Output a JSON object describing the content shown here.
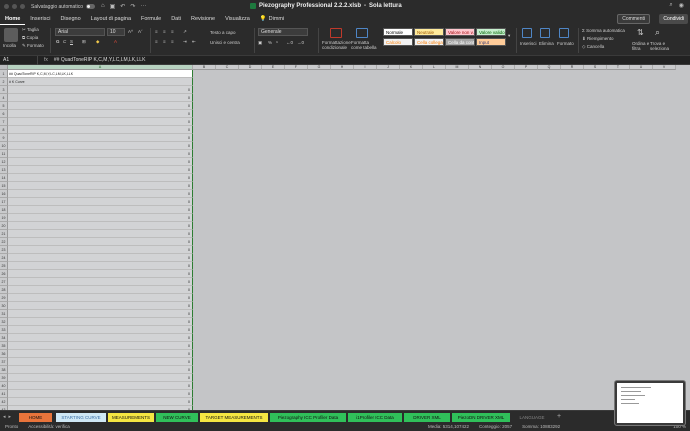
{
  "titlebar": {
    "autosave_label": "Salvataggio automatico",
    "document_title": "Piezography Professional 2.2.2.xlsb",
    "mode": "Sola lettura"
  },
  "menu": {
    "tabs": [
      "Home",
      "Inserisci",
      "Disegno",
      "Layout di pagina",
      "Formule",
      "Dati",
      "Revisione",
      "Visualizza"
    ],
    "tell_me": "Dimmi",
    "comments": "Commenti",
    "share": "Condividi"
  },
  "ribbon": {
    "paste": "Incolla",
    "cut": "Taglia",
    "copy": "Copia",
    "format_painter": "Formato",
    "font_name": "Arial",
    "font_size": "10",
    "wrap_text": "Testo a capo",
    "merge_center": "Unisci e centra",
    "number_format": "Generale",
    "conditional_format": "Formattazione condizionale",
    "format_as_table": "Formatta come tabella",
    "cell_styles": [
      {
        "label": "Normale",
        "bg": "#ffffff",
        "fg": "#000000"
      },
      {
        "label": "Neutrale",
        "bg": "#ffeb9c",
        "fg": "#9c5700"
      },
      {
        "label": "Valore non v...",
        "bg": "#ffc7ce",
        "fg": "#9c0006"
      },
      {
        "label": "Valore valido",
        "bg": "#c6efce",
        "fg": "#006100"
      },
      {
        "label": "Calcolo",
        "bg": "#f2f2f2",
        "fg": "#fa7d00"
      },
      {
        "label": "Cella collegata",
        "bg": "#f2f2f2",
        "fg": "#fa7d00"
      },
      {
        "label": "Cella da cont...",
        "bg": "#a5a5a5",
        "fg": "#ffffff"
      },
      {
        "label": "Input",
        "bg": "#ffcc99",
        "fg": "#3f3f76"
      }
    ],
    "insert": "Inserisci",
    "delete": "Elimina",
    "format": "Formato",
    "autosum": "Somma automatica",
    "fill": "Riempimento",
    "clear": "Cancella",
    "sort_filter": "Ordina e filtra",
    "find_select": "Trova e seleziona"
  },
  "formula_bar": {
    "name_box": "A1",
    "fx": "fx",
    "content": "## QuadToneRIP K,C,M,Y,LC,LM,LK,LLK"
  },
  "grid": {
    "columns": [
      "A",
      "B",
      "C",
      "D",
      "E",
      "F",
      "G",
      "H",
      "I",
      "J",
      "K",
      "L",
      "M",
      "N",
      "O",
      "P",
      "Q",
      "R",
      "S",
      "T",
      "U",
      "V"
    ],
    "rows": [
      {
        "n": "1",
        "a": "## QuadToneRIP K,C,M,Y,LC,LM,LK,LLK",
        "v": ""
      },
      {
        "n": "2",
        "a": "# K Curve",
        "v": ""
      },
      {
        "n": "3",
        "a": "",
        "v": "0"
      },
      {
        "n": "4",
        "a": "",
        "v": "0"
      },
      {
        "n": "5",
        "a": "",
        "v": "0"
      },
      {
        "n": "6",
        "a": "",
        "v": "0"
      },
      {
        "n": "7",
        "a": "",
        "v": "0"
      },
      {
        "n": "8",
        "a": "",
        "v": "0"
      },
      {
        "n": "9",
        "a": "",
        "v": "0"
      },
      {
        "n": "10",
        "a": "",
        "v": "0"
      },
      {
        "n": "11",
        "a": "",
        "v": "0"
      },
      {
        "n": "12",
        "a": "",
        "v": "0"
      },
      {
        "n": "13",
        "a": "",
        "v": "0"
      },
      {
        "n": "14",
        "a": "",
        "v": "0"
      },
      {
        "n": "15",
        "a": "",
        "v": "0"
      },
      {
        "n": "16",
        "a": "",
        "v": "0"
      },
      {
        "n": "17",
        "a": "",
        "v": "0"
      },
      {
        "n": "18",
        "a": "",
        "v": "0"
      },
      {
        "n": "19",
        "a": "",
        "v": "0"
      },
      {
        "n": "20",
        "a": "",
        "v": "0"
      },
      {
        "n": "21",
        "a": "",
        "v": "0"
      },
      {
        "n": "22",
        "a": "",
        "v": "0"
      },
      {
        "n": "23",
        "a": "",
        "v": "0"
      },
      {
        "n": "24",
        "a": "",
        "v": "0"
      },
      {
        "n": "25",
        "a": "",
        "v": "0"
      },
      {
        "n": "26",
        "a": "",
        "v": "0"
      },
      {
        "n": "27",
        "a": "",
        "v": "0"
      },
      {
        "n": "28",
        "a": "",
        "v": "0"
      },
      {
        "n": "29",
        "a": "",
        "v": "0"
      },
      {
        "n": "30",
        "a": "",
        "v": "0"
      },
      {
        "n": "31",
        "a": "",
        "v": "0"
      },
      {
        "n": "32",
        "a": "",
        "v": "0"
      },
      {
        "n": "33",
        "a": "",
        "v": "0"
      },
      {
        "n": "34",
        "a": "",
        "v": "0"
      },
      {
        "n": "35",
        "a": "",
        "v": "0"
      },
      {
        "n": "36",
        "a": "",
        "v": "0"
      },
      {
        "n": "37",
        "a": "",
        "v": "0"
      },
      {
        "n": "38",
        "a": "",
        "v": "0"
      },
      {
        "n": "39",
        "a": "",
        "v": "0"
      },
      {
        "n": "40",
        "a": "",
        "v": "0"
      },
      {
        "n": "41",
        "a": "",
        "v": "0"
      },
      {
        "n": "42",
        "a": "",
        "v": "0"
      },
      {
        "n": "43",
        "a": "",
        "v": "0"
      }
    ]
  },
  "sheets": [
    {
      "label": "HOME",
      "bg": "#e8743b",
      "fg": "#111111"
    },
    {
      "label": "STARTING CURVE",
      "bg": "#cfe8f5",
      "fg": "#3a6ea5"
    },
    {
      "label": "MEASUREMENTS",
      "bg": "#f5e642",
      "fg": "#111111"
    },
    {
      "label": "NEW CURVE",
      "bg": "#30c05a",
      "fg": "#111111"
    },
    {
      "label": "TARGET MEASUREMENTS",
      "bg": "#f5e642",
      "fg": "#111111"
    },
    {
      "label": "Piezography ICC Profiler Data",
      "bg": "#30c05a",
      "fg": "#111111"
    },
    {
      "label": "i1Profiler ICC Data",
      "bg": "#30c05a",
      "fg": "#111111"
    },
    {
      "label": "DRIVER XML",
      "bg": "#30c05a",
      "fg": "#111111"
    },
    {
      "label": "PiezoDN DRIVER XML",
      "bg": "#30c05a",
      "fg": "#111111"
    },
    {
      "label": "LANGUAGE",
      "bg": "#2b2b2b",
      "fg": "#888888"
    }
  ],
  "status": {
    "ready": "Pronto",
    "accessibility": "Accessibilità: verifica",
    "average": "Media: 5314,107422",
    "count": "Conteggio: 2057",
    "sum": "Somma: 10883292",
    "zoom": "100 %"
  }
}
